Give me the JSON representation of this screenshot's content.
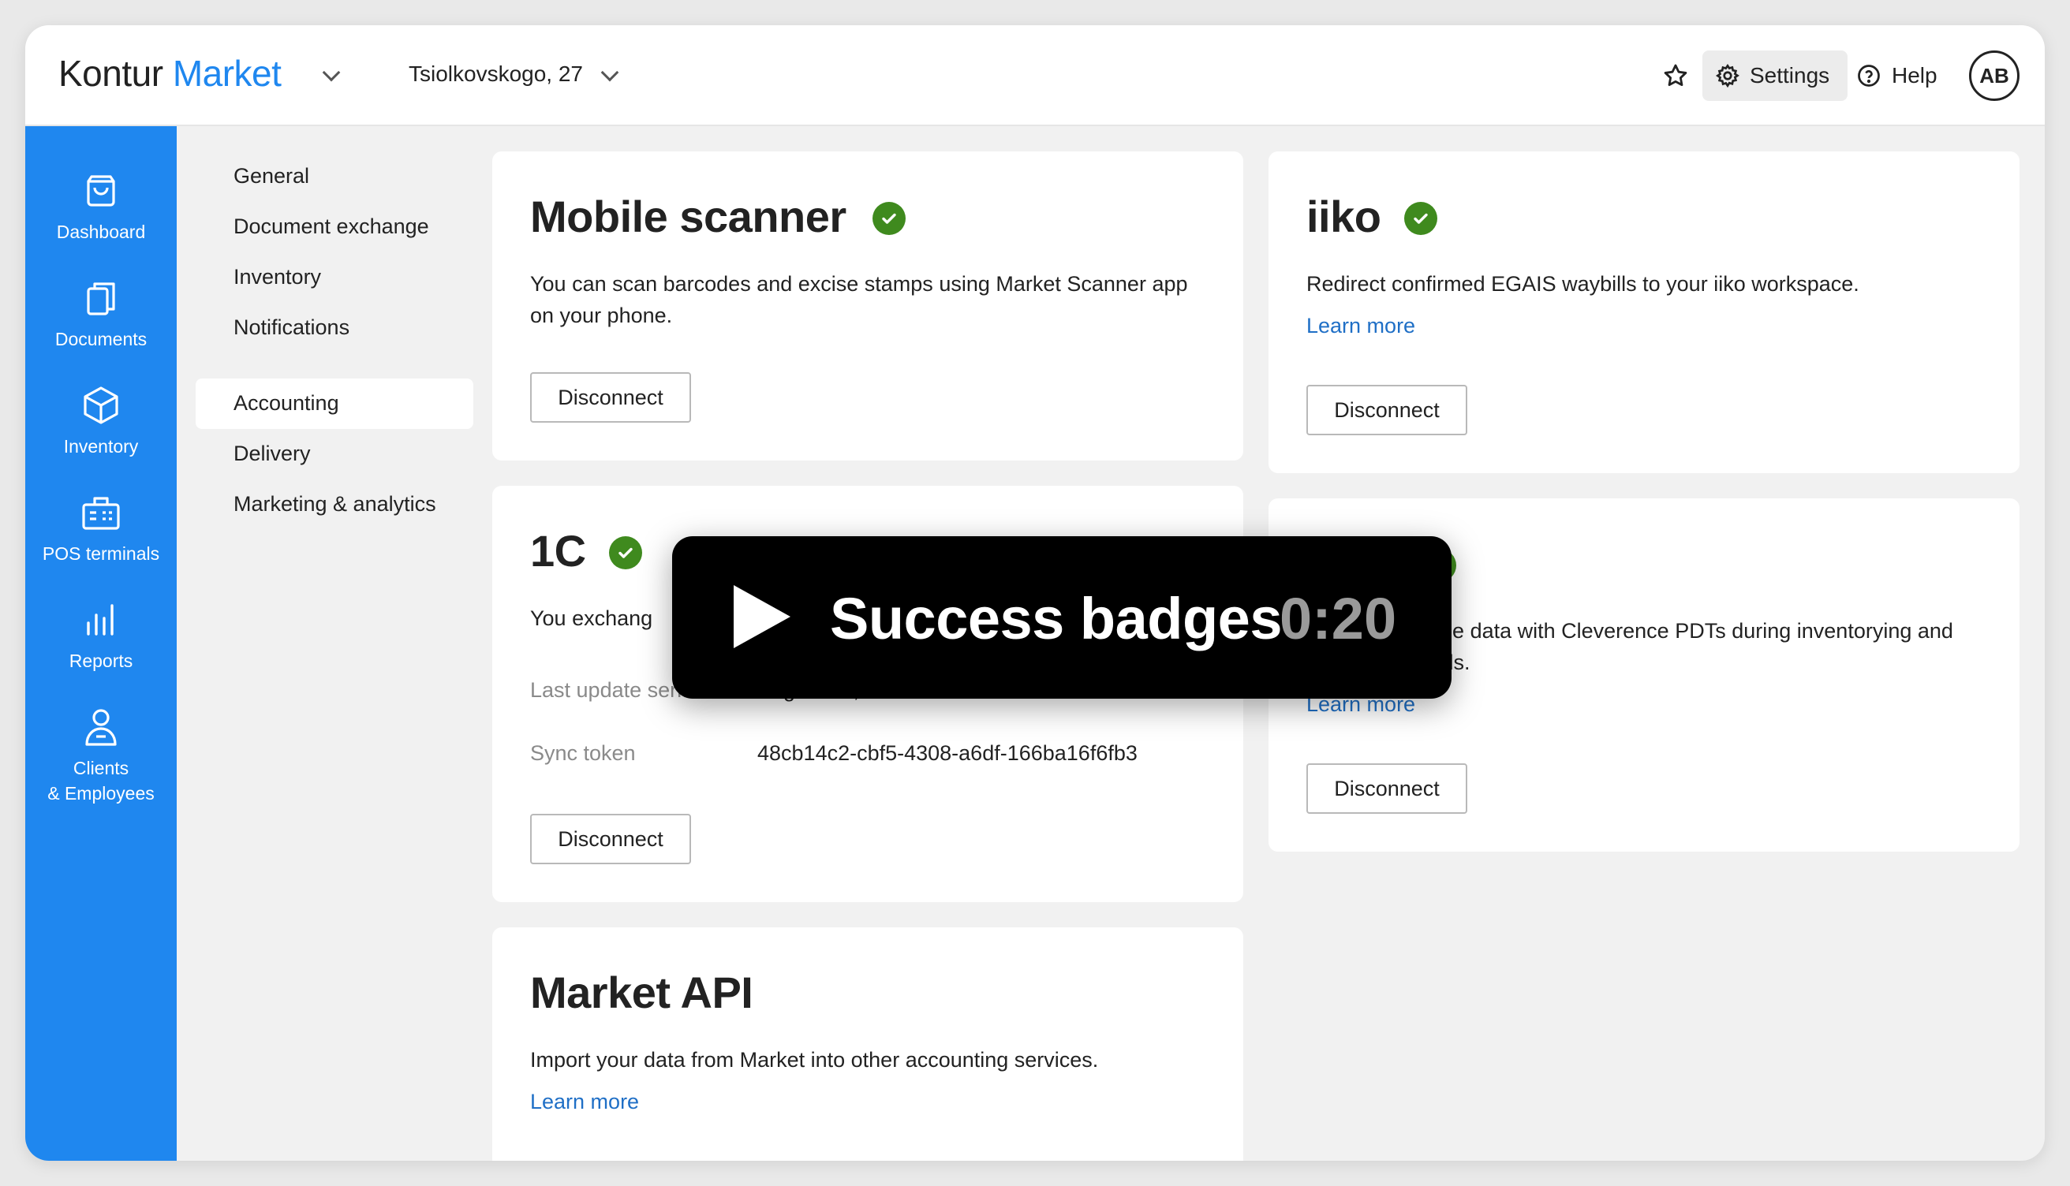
{
  "header": {
    "logo_part1": "Kontur",
    "logo_part2": "Market",
    "address": "Tsiolkovskogo, 27",
    "settings_label": "Settings",
    "help_label": "Help",
    "avatar_initials": "AB"
  },
  "sidebar": {
    "items": [
      {
        "label": "Dashboard",
        "icon": "shopping-bag-icon"
      },
      {
        "label": "Documents",
        "icon": "documents-icon"
      },
      {
        "label": "Inventory",
        "icon": "box-icon"
      },
      {
        "label": "POS terminals",
        "icon": "pos-terminal-icon"
      },
      {
        "label": "Reports",
        "icon": "bar-chart-icon"
      },
      {
        "label": "Clients",
        "label2": "& Employees",
        "icon": "person-icon"
      }
    ]
  },
  "submenu": {
    "items": [
      "General",
      "Document exchange",
      "Inventory",
      "Notifications",
      "Accounting",
      "Delivery",
      "Marketing & analytics"
    ],
    "active": "Accounting"
  },
  "cards": {
    "mobile_scanner": {
      "title": "Mobile scanner",
      "description": "You can scan barcodes and excise stamps using Market Scanner app on your phone.",
      "button": "Disconnect"
    },
    "iiko": {
      "title": "iiko",
      "description": "Redirect confirmed EGAIS waybills to your iiko workspace.",
      "link": "Learn more",
      "button": "Disconnect"
    },
    "onec": {
      "title": "1C",
      "description": "You exchang",
      "last_update_label": "Last update sent",
      "last_update_value": "August 10, 2023",
      "sync_token_label": "Sync token",
      "sync_token_value": "48cb14c2-cbf5-4308-a6df-166ba16f6fb3",
      "button": "Disconnect"
    },
    "cleverence": {
      "description_line1": "ange data with Cleverence PDTs during inventorying and",
      "description_line2": "ybills.",
      "link": "Learn more",
      "button": "Disconnect"
    },
    "market_api": {
      "title": "Market API",
      "description": "Import your data from Market into other accounting services.",
      "link": "Learn more"
    }
  },
  "video": {
    "title": "Success badges",
    "time": "0:20"
  },
  "colors": {
    "brand_blue": "#1f87ef",
    "success_green": "#3f8a1e",
    "link_blue": "#1f6fc6"
  }
}
